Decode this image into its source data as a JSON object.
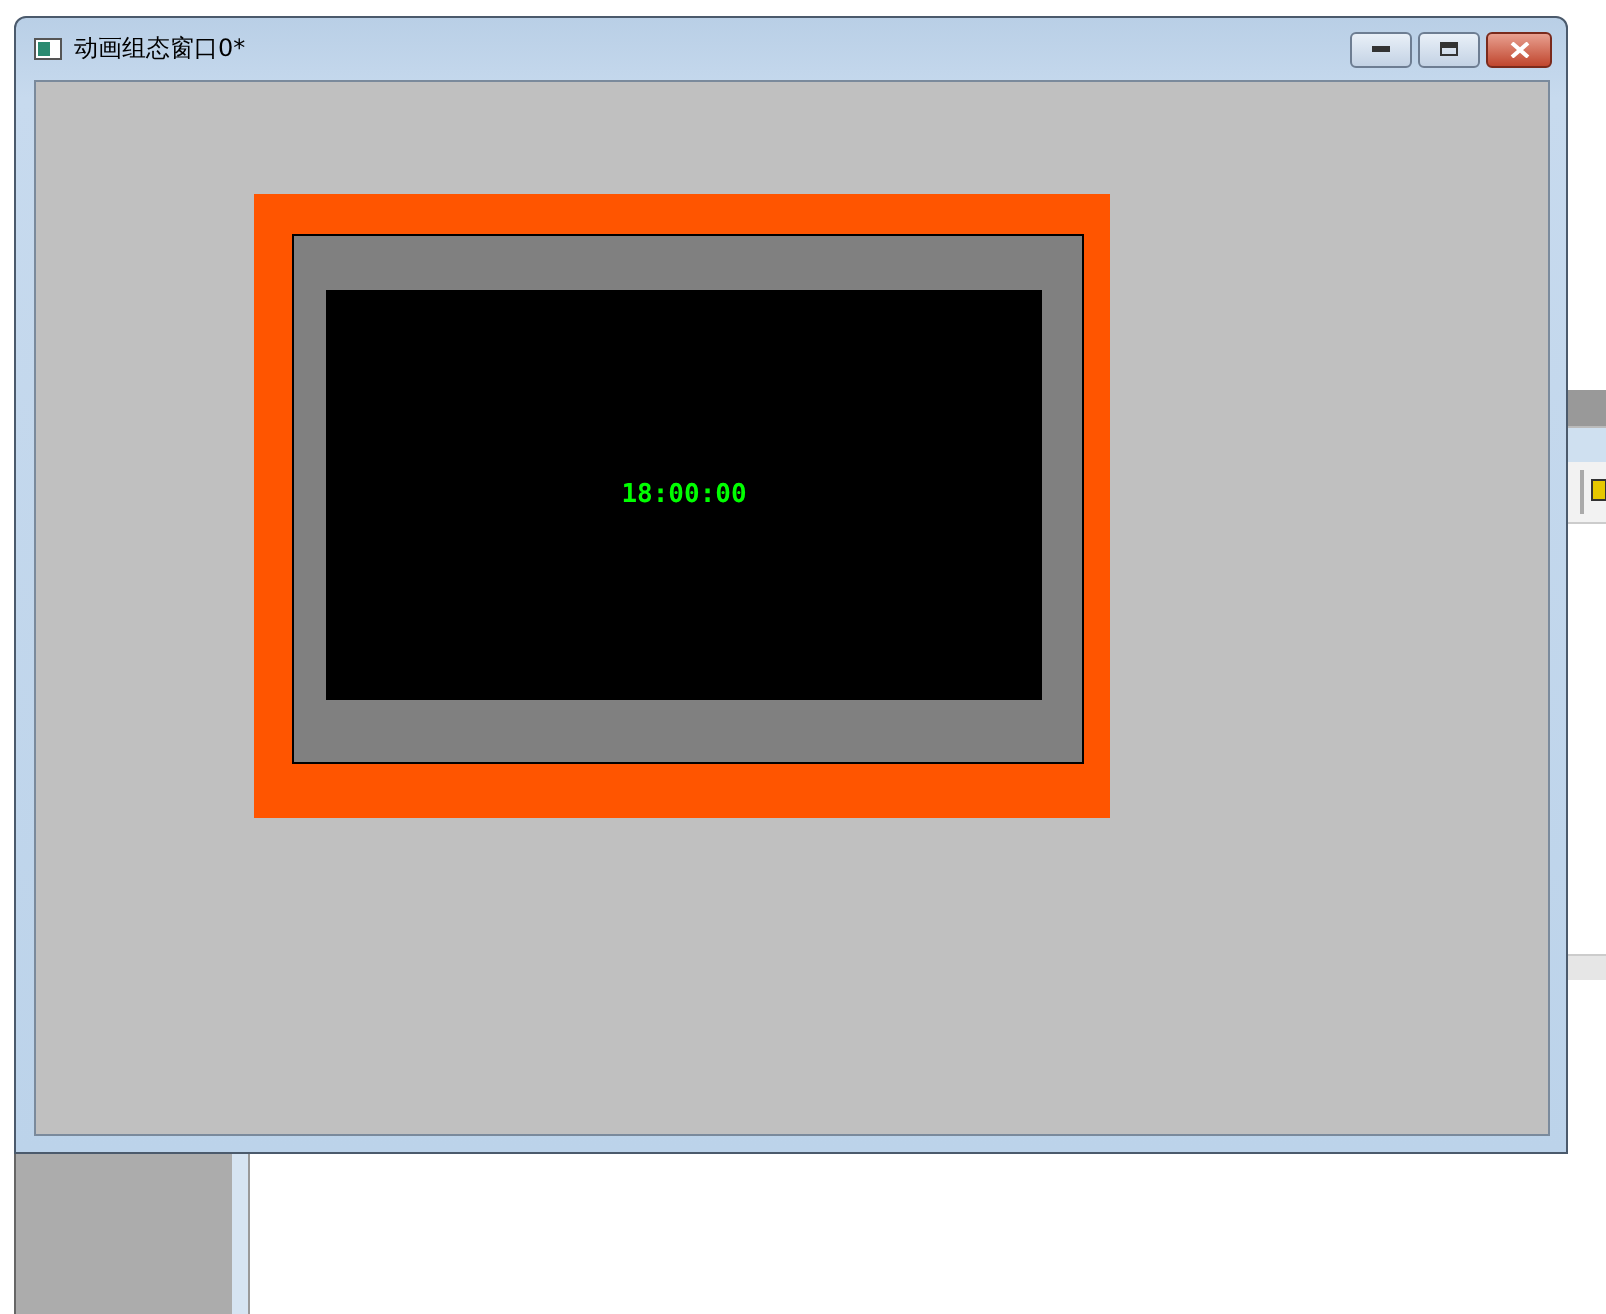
{
  "window": {
    "title": "动画组态窗口0*"
  },
  "clock_display": {
    "time": "18:00:00"
  }
}
